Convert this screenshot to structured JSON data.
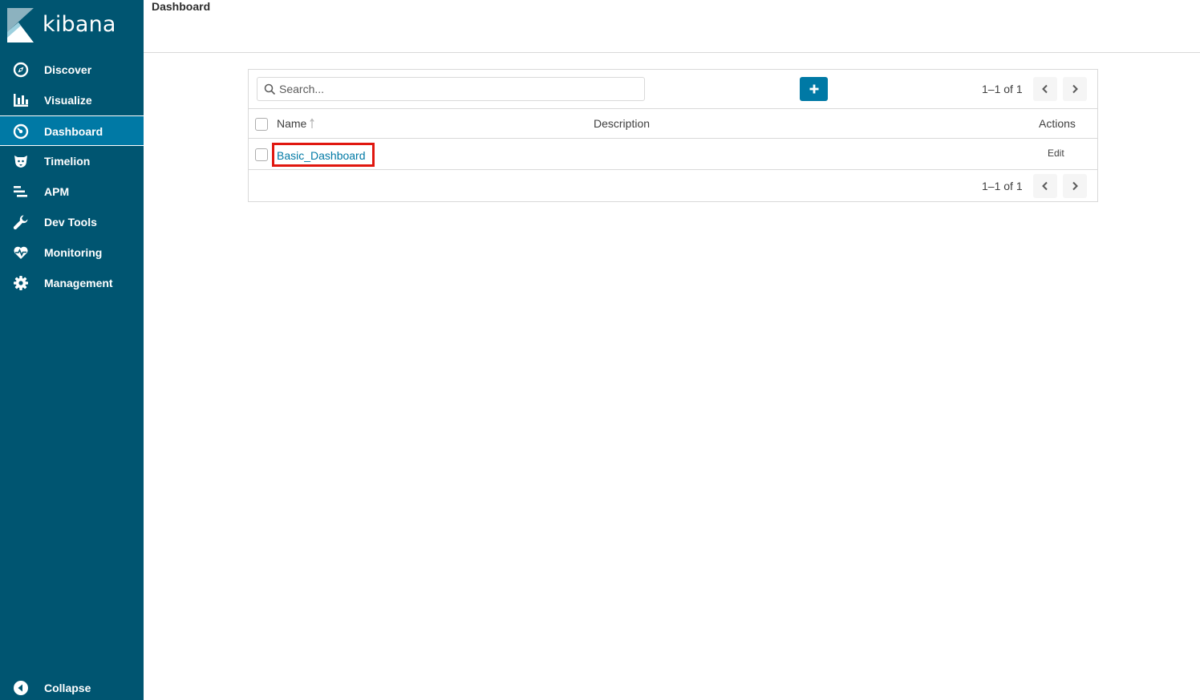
{
  "brand": {
    "name": "kibana"
  },
  "sidebar": {
    "items": [
      {
        "label": "Discover",
        "icon": "compass-icon"
      },
      {
        "label": "Visualize",
        "icon": "bar-chart-icon"
      },
      {
        "label": "Dashboard",
        "icon": "dashboard-icon",
        "active": true
      },
      {
        "label": "Timelion",
        "icon": "timelion-icon"
      },
      {
        "label": "APM",
        "icon": "apm-icon"
      },
      {
        "label": "Dev Tools",
        "icon": "wrench-icon"
      },
      {
        "label": "Monitoring",
        "icon": "heartbeat-icon"
      },
      {
        "label": "Management",
        "icon": "gear-icon"
      }
    ],
    "collapse_label": "Collapse"
  },
  "header": {
    "title": "Dashboard"
  },
  "panel": {
    "search": {
      "placeholder": "Search..."
    },
    "pager_text": "1–1 of 1",
    "columns": {
      "name": "Name",
      "description": "Description",
      "actions": "Actions"
    },
    "rows": [
      {
        "name": "Basic_Dashboard",
        "description": "",
        "action": "Edit"
      }
    ],
    "footer_pager_text": "1–1 of 1"
  },
  "colors": {
    "sidebar_bg": "#005571",
    "active_bg": "#0079a5",
    "accent": "#0079a5",
    "highlight_border": "#e0170f"
  }
}
